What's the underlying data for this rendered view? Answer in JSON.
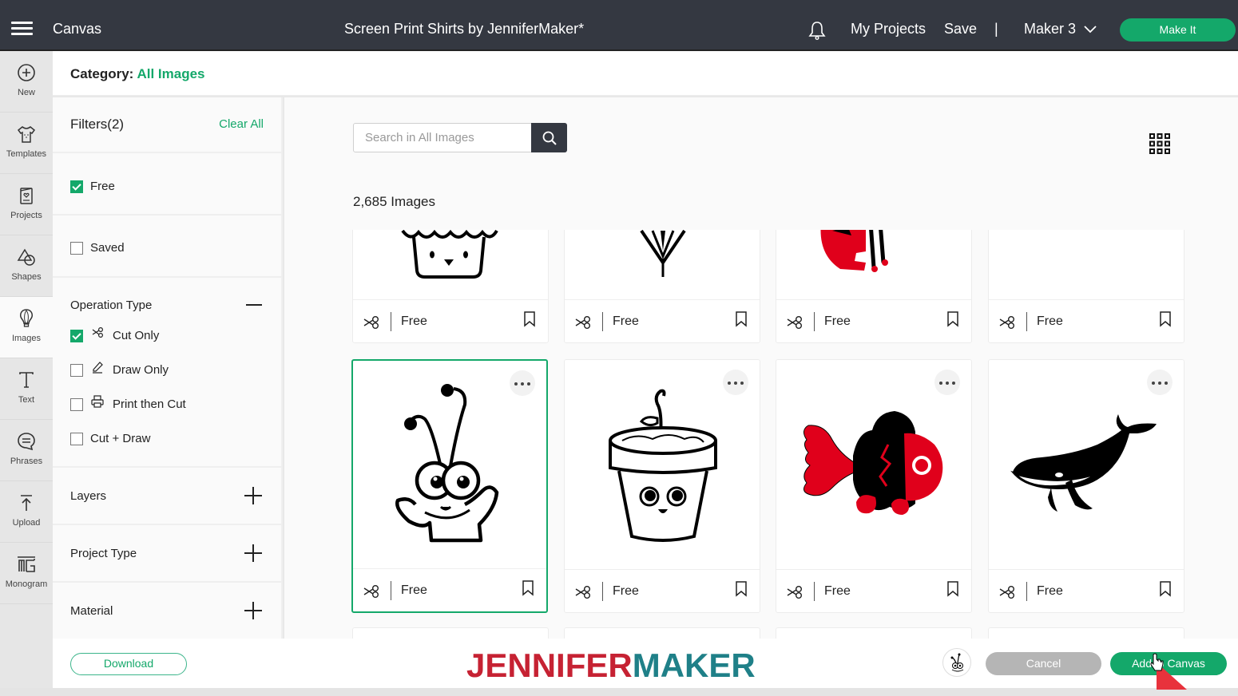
{
  "topbar": {
    "menu_icon": "hamburger-icon",
    "app_title": "Canvas",
    "document_title": "Screen Print Shirts by JenniferMaker*",
    "notification_icon": "bell-icon",
    "my_projects": "My Projects",
    "save": "Save",
    "separator": "|",
    "machine": "Maker 3",
    "make_it": "Make It"
  },
  "leftnav": {
    "items": [
      {
        "label": "New",
        "icon": "plus-circle-icon"
      },
      {
        "label": "Templates",
        "icon": "tshirt-icon"
      },
      {
        "label": "Projects",
        "icon": "card-heart-icon"
      },
      {
        "label": "Shapes",
        "icon": "shapes-icon"
      },
      {
        "label": "Images",
        "icon": "lightbulb-icon",
        "active": true
      },
      {
        "label": "Text",
        "icon": "text-icon"
      },
      {
        "label": "Phrases",
        "icon": "speech-bubble-icon"
      },
      {
        "label": "Upload",
        "icon": "upload-icon"
      },
      {
        "label": "Monogram",
        "icon": "monogram-icon"
      }
    ]
  },
  "category": {
    "label": "Category:",
    "value": "All Images"
  },
  "filters": {
    "title": "Filters(2)",
    "clear_all": "Clear All",
    "free": {
      "label": "Free",
      "checked": true
    },
    "saved": {
      "label": "Saved",
      "checked": false
    },
    "operation_type": {
      "title": "Operation Type",
      "options": [
        {
          "label": "Cut Only",
          "checked": true,
          "icon": "scissors-icon"
        },
        {
          "label": "Draw Only",
          "checked": false,
          "icon": "pen-icon"
        },
        {
          "label": "Print then Cut",
          "checked": false,
          "icon": "printer-icon"
        },
        {
          "label": "Cut + Draw",
          "checked": false
        }
      ]
    },
    "collapsed_sections": [
      "Layers",
      "Project Type",
      "Material"
    ]
  },
  "search": {
    "placeholder": "Search in All Images",
    "value": ""
  },
  "results": {
    "count_label": "2,685 Images",
    "row1": [
      {
        "image": "cupcake-face",
        "price": "Free"
      },
      {
        "image": "flower-stem",
        "price": "Free"
      },
      {
        "image": "red-cat",
        "price": "Free"
      },
      {
        "image": "blank",
        "price": "Free"
      }
    ],
    "row2": [
      {
        "image": "bug-character",
        "price": "Free",
        "selected": true
      },
      {
        "image": "flower-pot-face",
        "price": "Free"
      },
      {
        "image": "red-black-fish",
        "price": "Free"
      },
      {
        "image": "whale",
        "price": "Free"
      }
    ]
  },
  "bottom": {
    "download": "Download",
    "logo_part1": "JENNIFER",
    "logo_part2": "MAKER",
    "cancel": "Cancel",
    "add_to_canvas": "Add to Canvas"
  },
  "colors": {
    "accent_green": "#14a86a",
    "topbar": "#343841",
    "logo_red": "#c62233",
    "logo_teal": "#1f8088"
  }
}
